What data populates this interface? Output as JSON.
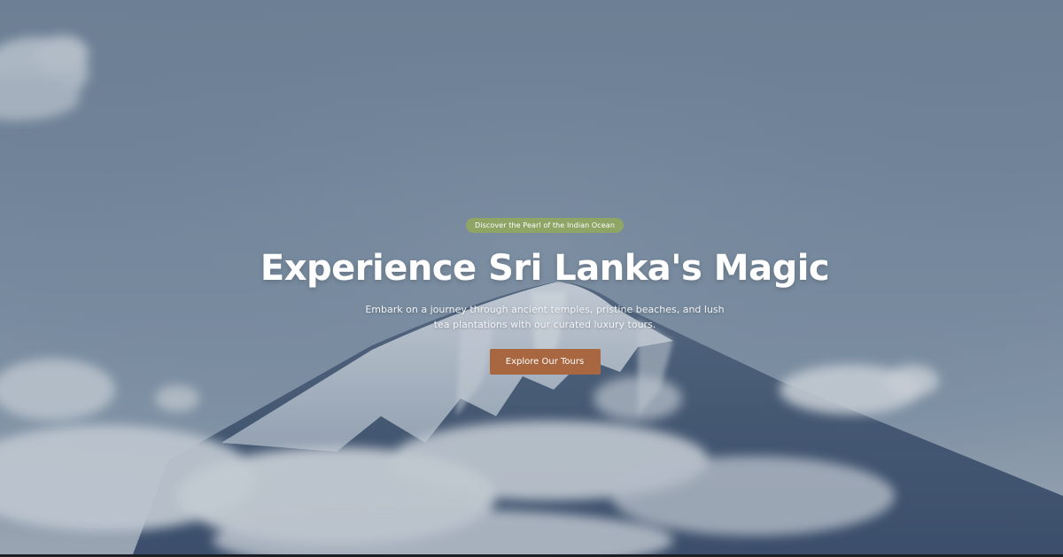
{
  "hero": {
    "badge": "Discover the Pearl of the Indian Ocean",
    "title": "Experience Sri Lanka's Magic",
    "subtitle": "Embark on a journey through ancient temples, pristine beaches, and lush tea plantations with our curated luxury tours.",
    "cta_label": "Explore Our Tours",
    "background_image": "snow-capped-mountain-with-clouds"
  },
  "colors": {
    "badge_bg": "#8fa566",
    "cta_bg": "#a86740",
    "text": "#ffffff",
    "sky": "#76889d"
  }
}
